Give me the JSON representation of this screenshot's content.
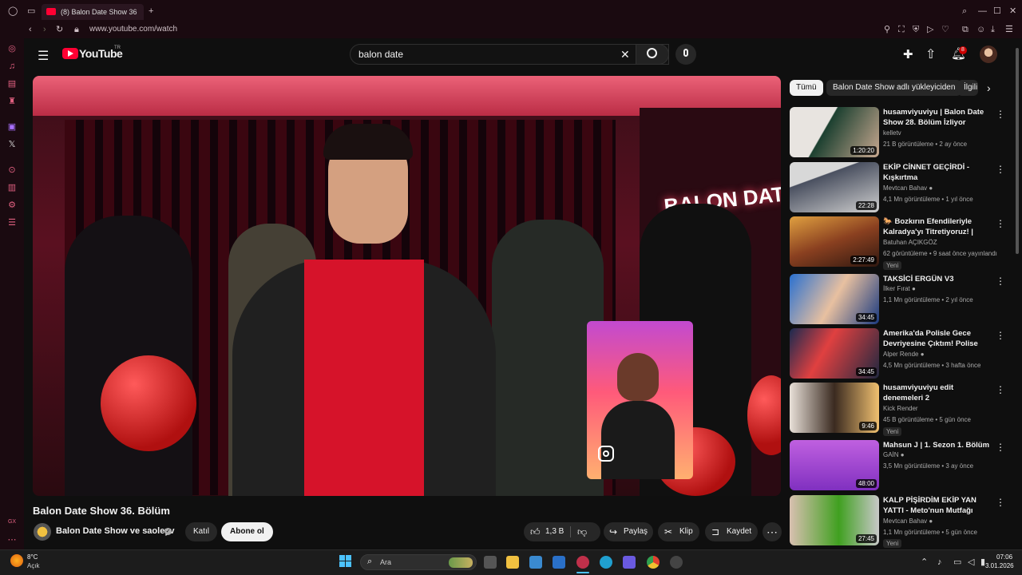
{
  "browser": {
    "tab_title": "(8) Balon Date Show 36",
    "url": "www.youtube.com/watch",
    "new_tab_label": "+"
  },
  "youtube": {
    "logo_text": "YouTube",
    "logo_region": "TR",
    "search_value": "balon date",
    "notification_count": "8"
  },
  "video": {
    "title": "Balon Date Show 36. Bölüm",
    "channel": "Balon Date Show ve saoleyv",
    "join_label": "Katıl",
    "subscribe_label": "Abone ol",
    "likes": "1,3 B",
    "share_label": "Paylaş",
    "clip_label": "Klip",
    "save_label": "Kaydet",
    "overlay_logo": "BALON DATE SHOW"
  },
  "chips": [
    {
      "label": "Tümü",
      "active": true
    },
    {
      "label": "Balon Date Show adlı yükleyiciden",
      "active": false
    },
    {
      "label": "İlgili",
      "active": false
    }
  ],
  "recommendations": [
    {
      "title": "husamviyuviyu | Balon Date Show 28. Bölüm İzliyor",
      "channel": "kelletv",
      "meta": "21 B görüntüleme • 2 ay önce",
      "duration": "1:20:20",
      "new": "",
      "verified": false
    },
    {
      "title": "EKİP CİNNET GEÇİRDİ - Kışkırtma",
      "channel": "Mevtcan Bahav",
      "meta": "4,1 Mn görüntüleme • 1 yıl önce",
      "duration": "22:28",
      "new": "",
      "verified": true
    },
    {
      "title": "🐎 Bozkırın Efendileriyle Kalradya'yı Titretiyoruz! | Moun…",
      "channel": "Batuhan AÇIKGÖZ",
      "meta": "62 görüntüleme • 9 saat önce yayınlandı",
      "duration": "2:27:49",
      "new": "Yeni",
      "verified": false
    },
    {
      "title": "TAKSİCİ ERGÜN V3",
      "channel": "İlker Fırat",
      "meta": "1,1 Mn görüntüleme • 2 yıl önce",
      "duration": "34:45",
      "new": "",
      "verified": true
    },
    {
      "title": "Amerika'da Polisle Gece Devriyesine Çıktım! Polise Küf…",
      "channel": "Alper Rende",
      "meta": "4,5 Mn görüntüleme • 3 hafta önce",
      "duration": "34:45",
      "new": "",
      "verified": true
    },
    {
      "title": "husamviyuviyu edit denemeleri 2",
      "channel": "Kick Render",
      "meta": "45 B görüntüleme • 5 gün önce",
      "duration": "9:46",
      "new": "Yeni",
      "verified": false
    },
    {
      "title": "Mahsun J | 1. Sezon 1. Bölüm",
      "channel": "GAİN",
      "meta": "3,5 Mn görüntüleme • 3 ay önce",
      "duration": "48:00",
      "new": "",
      "verified": true
    },
    {
      "title": "KALP PİŞİRDİM EKİP YAN YATTI - Meto'nun Mutfağı",
      "channel": "Mevtcan Bahav",
      "meta": "1,1 Mn görüntüleme • 5 gün önce",
      "duration": "27:45",
      "new": "Yeni",
      "verified": true
    }
  ],
  "taskbar": {
    "weather_temp": "8°C",
    "weather_desc": "Açık",
    "search_placeholder": "Ara",
    "time": "07:06",
    "date": "3.01.2026"
  },
  "sidebar_bottom_label": "GX"
}
